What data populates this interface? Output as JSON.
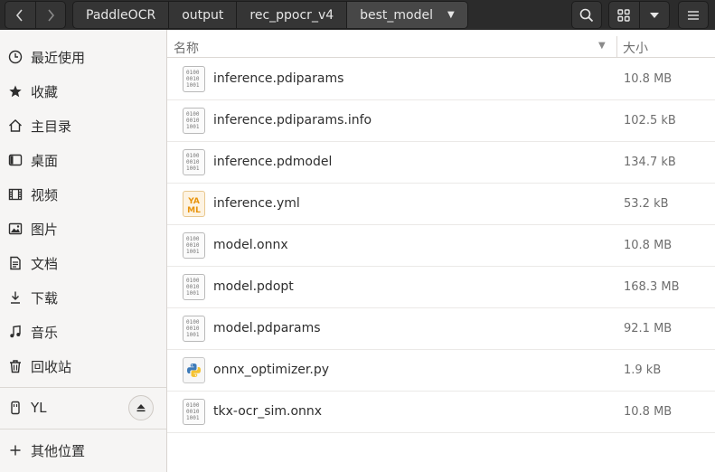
{
  "breadcrumb": [
    "PaddleOCR",
    "output",
    "rec_ppocr_v4",
    "best_model"
  ],
  "sidebar": {
    "items": [
      {
        "label": "最近使用",
        "icon": "clock-icon"
      },
      {
        "label": "收藏",
        "icon": "star-icon"
      },
      {
        "label": "主目录",
        "icon": "home-icon"
      },
      {
        "label": "桌面",
        "icon": "desktop-icon"
      },
      {
        "label": "视频",
        "icon": "video-icon"
      },
      {
        "label": "图片",
        "icon": "image-icon"
      },
      {
        "label": "文档",
        "icon": "document-icon"
      },
      {
        "label": "下载",
        "icon": "download-icon"
      },
      {
        "label": "音乐",
        "icon": "music-icon"
      },
      {
        "label": "回收站",
        "icon": "trash-icon"
      }
    ],
    "device": {
      "label": "YL",
      "icon": "usb-drive-icon"
    },
    "other": {
      "label": "其他位置",
      "icon": "plus-icon"
    }
  },
  "columns": {
    "name": "名称",
    "size": "大小"
  },
  "files": [
    {
      "name": "inference.pdiparams",
      "size": "10.8 MB",
      "icon": "binary-file-icon"
    },
    {
      "name": "inference.pdiparams.info",
      "size": "102.5 kB",
      "icon": "binary-file-icon"
    },
    {
      "name": "inference.pdmodel",
      "size": "134.7 kB",
      "icon": "binary-file-icon"
    },
    {
      "name": "inference.yml",
      "size": "53.2 kB",
      "icon": "yaml-file-icon"
    },
    {
      "name": "model.onnx",
      "size": "10.8 MB",
      "icon": "binary-file-icon"
    },
    {
      "name": "model.pdopt",
      "size": "168.3 MB",
      "icon": "binary-file-icon"
    },
    {
      "name": "model.pdparams",
      "size": "92.1 MB",
      "icon": "binary-file-icon"
    },
    {
      "name": "onnx_optimizer.py",
      "size": "1.9 kB",
      "icon": "python-file-icon"
    },
    {
      "name": "tkx-ocr_sim.onnx",
      "size": "10.8 MB",
      "icon": "binary-file-icon"
    }
  ],
  "binary_glyph": [
    "0100",
    "0010",
    "1001"
  ],
  "yaml_glyph": [
    "YA",
    "ML"
  ],
  "colors": {
    "headerbar": "#2b2b2b",
    "sidebar": "#f6f5f4",
    "yaml_accent": "#e8940c",
    "python_blue": "#3d7ab8",
    "python_yellow": "#f5c332"
  }
}
